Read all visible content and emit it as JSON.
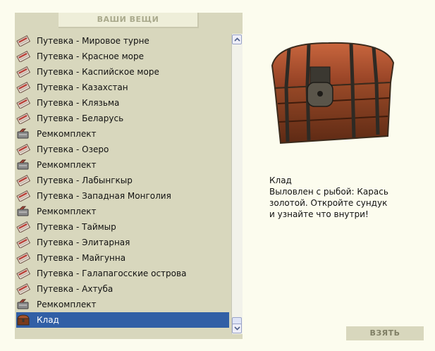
{
  "panel": {
    "title": "ВАШИ ВЕЩИ"
  },
  "items": [
    {
      "label": "Путевка - Мировое турне",
      "icon": "ticket-icon"
    },
    {
      "label": "Путевка - Красное море",
      "icon": "ticket-icon"
    },
    {
      "label": "Путевка - Каспийское море",
      "icon": "ticket-icon"
    },
    {
      "label": "Путевка - Казахстан",
      "icon": "ticket-icon"
    },
    {
      "label": "Путевка - Клязьма",
      "icon": "ticket-icon"
    },
    {
      "label": "Путевка - Беларусь",
      "icon": "ticket-icon"
    },
    {
      "label": "Ремкомплект",
      "icon": "repair-kit-icon"
    },
    {
      "label": "Путевка - Озеро",
      "icon": "ticket-icon"
    },
    {
      "label": "Ремкомплект",
      "icon": "repair-kit-icon"
    },
    {
      "label": "Путевка - Лабынгкыр",
      "icon": "ticket-icon"
    },
    {
      "label": "Путевка - Западная Монголия",
      "icon": "ticket-icon"
    },
    {
      "label": "Ремкомплект",
      "icon": "repair-kit-icon"
    },
    {
      "label": "Путевка - Таймыр",
      "icon": "ticket-icon"
    },
    {
      "label": "Путевка - Элитарная",
      "icon": "ticket-icon"
    },
    {
      "label": "Путевка - Майгунна",
      "icon": "ticket-icon"
    },
    {
      "label": "Путевка - Галапагосские острова",
      "icon": "ticket-icon"
    },
    {
      "label": "Путевка - Ахтуба",
      "icon": "ticket-icon"
    },
    {
      "label": "Ремкомплект",
      "icon": "repair-kit-icon"
    },
    {
      "label": "Клад",
      "icon": "chest-icon",
      "selected": true
    }
  ],
  "details": {
    "name": "Клад",
    "description_lines": [
      "Выловлен с рыбой: Карась",
      "золотой. Откройте сундук",
      "и узнайте что внутри!"
    ]
  },
  "take_button": {
    "label": "ВЗЯТЬ"
  },
  "colors": {
    "background": "#fcfcee",
    "panel": "#d8d7bd",
    "selection": "#315fa6"
  }
}
